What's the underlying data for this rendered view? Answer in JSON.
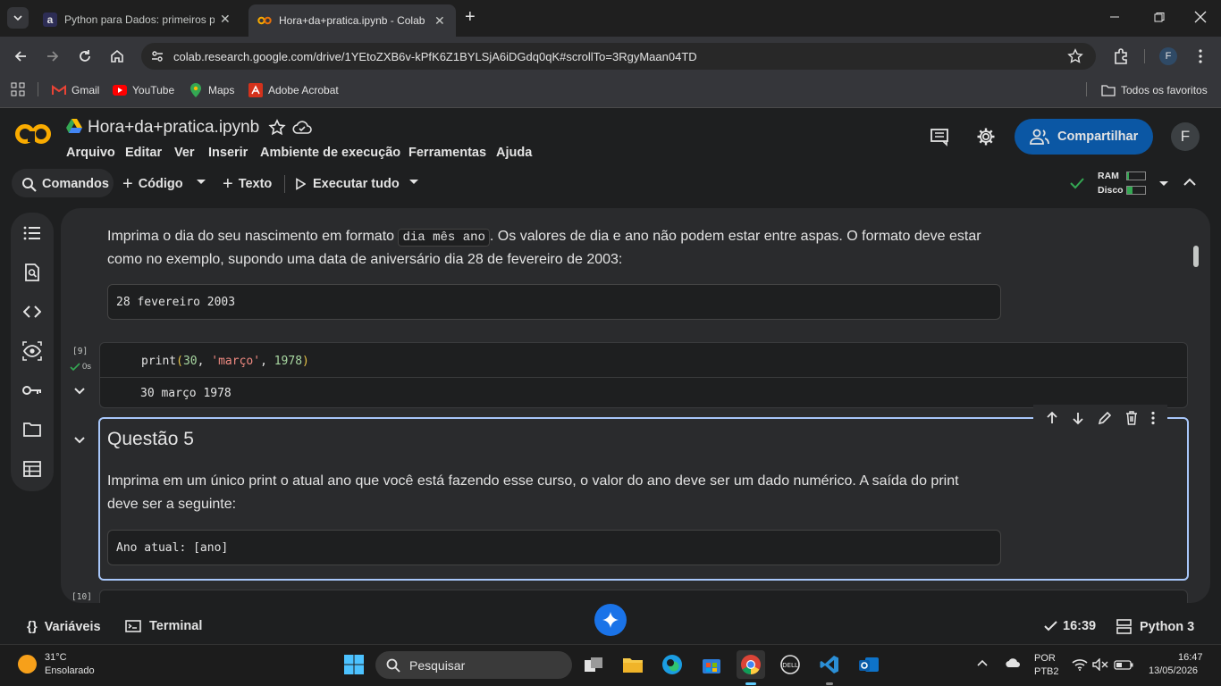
{
  "browser": {
    "tabs": [
      {
        "title": "Python para Dados: primeiros p",
        "icon": "alura-icon",
        "close": "✕"
      },
      {
        "title": "Hora+da+pratica.ipynb - Colab",
        "icon": "colab-icon",
        "close": "✕"
      }
    ],
    "new_tab": "+",
    "url": "colab.research.google.com/drive/1YEtoZXB6v-kPfK6Z1BYLSjA6iDGdq0qK#scrollTo=3RgyMaan04TD",
    "profile_initial": "F",
    "bookmarks": [
      "Gmail",
      "YouTube",
      "Maps",
      "Adobe Acrobat"
    ],
    "all_bookmarks": "Todos os favoritos"
  },
  "colab": {
    "logo": "CO",
    "notebook_title": "Hora+da+pratica.ipynb",
    "menu": [
      "Arquivo",
      "Editar",
      "Ver",
      "Inserir",
      "Ambiente de execução",
      "Ferramentas",
      "Ajuda"
    ],
    "share_label": "Compartilhar",
    "avatar_initial": "F",
    "toolbar": {
      "commands": "Comandos",
      "code": "Código",
      "text": "Texto",
      "run_all": "Executar tudo",
      "ram": "RAM",
      "disk": "Disco"
    }
  },
  "notebook": {
    "cell1": {
      "text_before": "Imprima o dia do seu nascimento em formato ",
      "inline_code": "dia mês ano",
      "text_after": ". Os valores de dia e ano não podem estar entre aspas. O formato deve estar",
      "text_line2": "como no exemplo, supondo uma data de aniversário dia 28 de fevereiro de 2003:",
      "example": "28 fevereiro 2003"
    },
    "cell2": {
      "exec_count": "[9]",
      "exec_time": "0s",
      "code_fn": "print",
      "code_open": "(",
      "code_num1": "30",
      "code_sep1": ", ",
      "code_str": "'março'",
      "code_sep2": ", ",
      "code_num2": "1978",
      "code_close": ")",
      "output": "30 março 1978"
    },
    "cell3": {
      "heading": "Questão 5",
      "text_line1": "Imprima em um único print o atual ano que você está fazendo esse curso, o valor do ano deve ser um dado numérico. A saída do print",
      "text_line2": "deve ser a seguinte:",
      "example": "Ano atual: [ano]"
    },
    "cell4": {
      "exec_count": "[10]"
    }
  },
  "statusbar": {
    "variables": "Variáveis",
    "terminal": "Terminal",
    "time": "16:39",
    "runtime": "Python 3"
  },
  "taskbar": {
    "weather_temp": "31°C",
    "weather_desc": "Ensolarado",
    "search_placeholder": "Pesquisar",
    "lang1": "POR",
    "lang2": "PTB2",
    "clock_time": "16:47",
    "clock_date": "13/05/2026"
  },
  "colors": {
    "accent_blue": "#0b57a4",
    "colab_orange": "#f9ab00",
    "selected_border": "#a8c7fa",
    "check_green": "#34a853"
  }
}
